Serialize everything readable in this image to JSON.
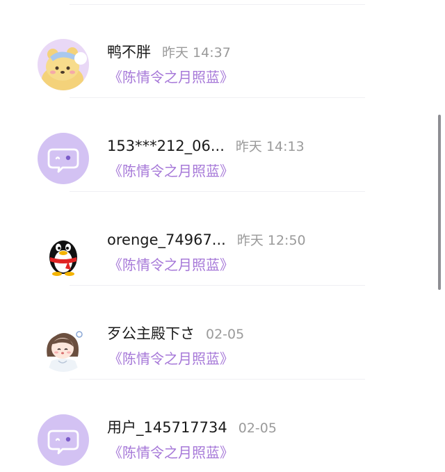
{
  "list": {
    "items": [
      {
        "name": "鸭不胖",
        "time": "昨天 14:37",
        "subtitle": "《陈情令之月照蓝》",
        "avatar": "bear-avatar-icon"
      },
      {
        "name": "153***212_06...",
        "time": "昨天 14:13",
        "subtitle": "《陈情令之月照蓝》",
        "avatar": "default-chat-avatar-icon"
      },
      {
        "name": "orenge_74967...",
        "time": "昨天 12:50",
        "subtitle": "《陈情令之月照蓝》",
        "avatar": "qq-penguin-avatar-icon"
      },
      {
        "name": "歹公主殿下さ",
        "time": "02-05",
        "subtitle": "《陈情令之月照蓝》",
        "avatar": "anime-girl-avatar-icon"
      },
      {
        "name": "用户_145717734",
        "time": "02-05",
        "subtitle": "《陈情令之月照蓝》",
        "avatar": "default-chat-avatar-icon"
      }
    ]
  },
  "colors": {
    "accent": "#a678d8",
    "avatar_bg": "#d3c2f3",
    "name": "#1a1a1a",
    "time": "#9a9a9a"
  }
}
